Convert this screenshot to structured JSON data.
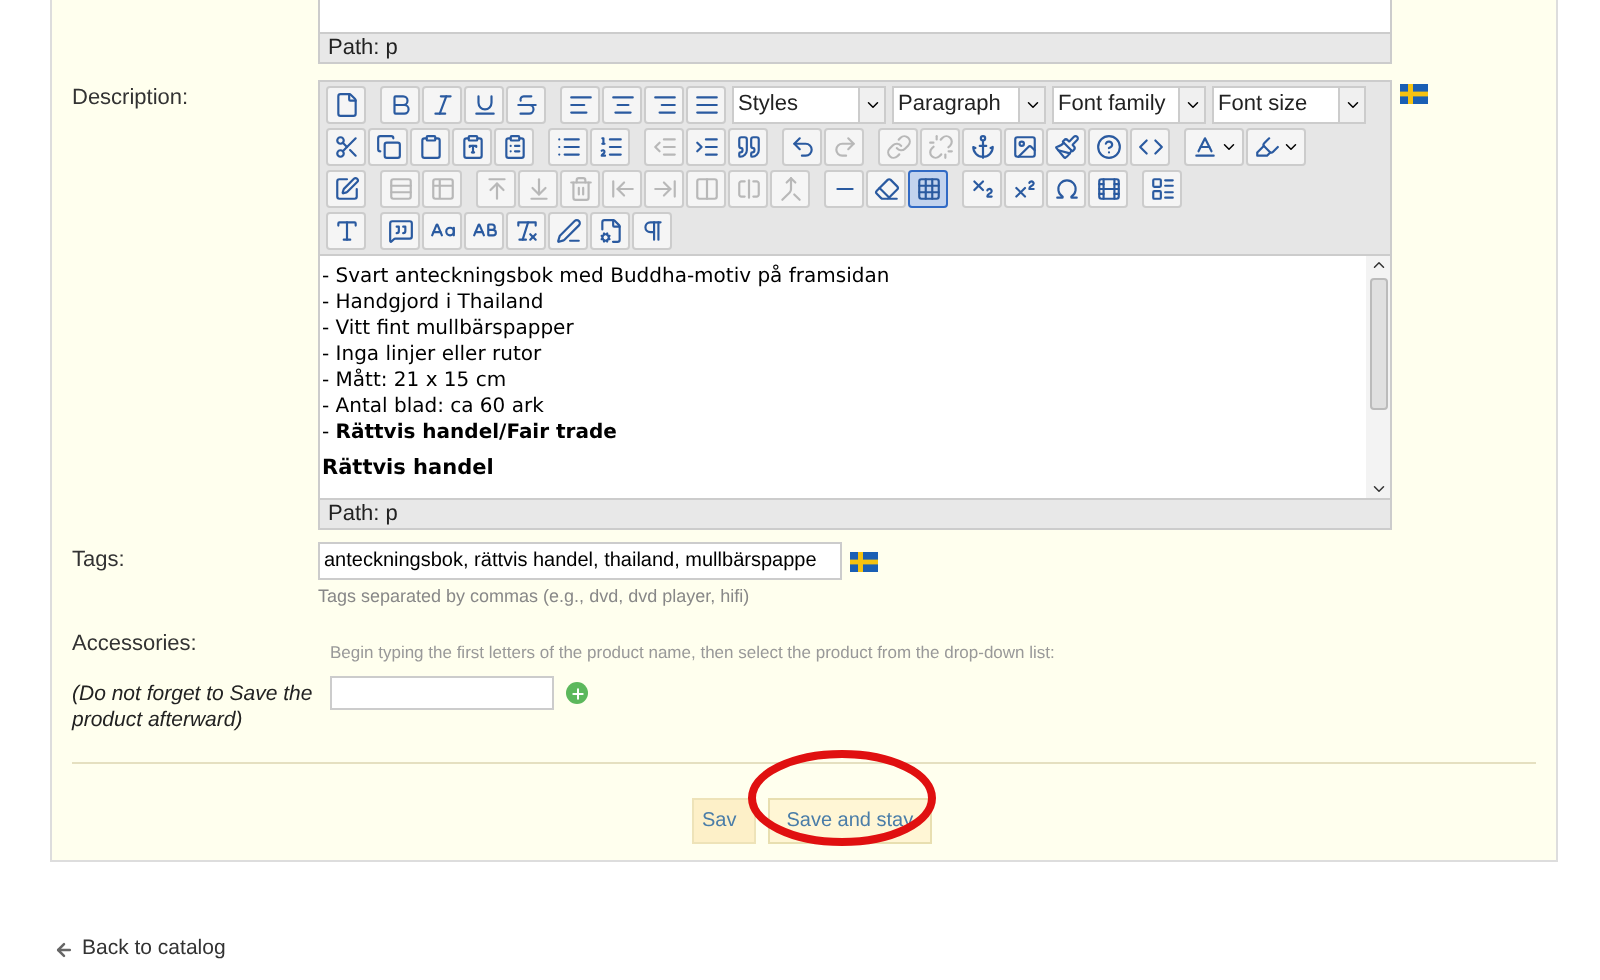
{
  "top_editor": {
    "path": "Path: p"
  },
  "description": {
    "label": "Description:",
    "toolbar_rows": [
      {
        "buttons": [
          {
            "disabled": false
          },
          {
            "disabled": false
          },
          {
            "disabled": false
          },
          {
            "disabled": false
          },
          {
            "disabled": false
          },
          {
            "disabled": false
          },
          {
            "disabled": false
          },
          {
            "disabled": false
          },
          {
            "disabled": false
          }
        ]
      },
      {
        "buttons": [
          {
            "disabled": false
          },
          {
            "disabled": false
          },
          {
            "disabled": false
          },
          {
            "disabled": false
          },
          {
            "disabled": false
          },
          {
            "disabled": false
          },
          {
            "disabled": false
          },
          {
            "disabled": true
          },
          {
            "disabled": false
          },
          {
            "disabled": false
          },
          {
            "disabled": false
          },
          {
            "disabled": true
          },
          {
            "disabled": true
          },
          {
            "disabled": true
          },
          {
            "disabled": false
          },
          {
            "disabled": false
          },
          {
            "disabled": false
          },
          {
            "disabled": false
          },
          {
            "disabled": false
          },
          {
            "disabled": false
          },
          {
            "disabled": false
          }
        ]
      },
      {
        "buttons": [
          {
            "disabled": false
          },
          {
            "disabled": true
          },
          {
            "disabled": true
          },
          {
            "disabled": true
          },
          {
            "disabled": true
          },
          {
            "disabled": true
          },
          {
            "disabled": true
          },
          {
            "disabled": true
          },
          {
            "disabled": true
          },
          {
            "disabled": true
          },
          {
            "disabled": true
          },
          {
            "disabled": false
          },
          {
            "disabled": false
          },
          {
            "disabled": false,
            "active": true
          },
          {
            "disabled": false
          },
          {
            "disabled": false
          },
          {
            "disabled": false
          },
          {
            "disabled": false
          },
          {
            "disabled": false
          }
        ]
      },
      {
        "buttons": [
          {
            "disabled": false
          },
          {
            "disabled": false
          },
          {
            "disabled": false
          },
          {
            "disabled": false
          },
          {
            "disabled": false
          },
          {
            "disabled": false
          },
          {
            "disabled": false
          },
          {
            "disabled": false
          }
        ]
      }
    ],
    "selects": [
      "Styles",
      "Paragraph",
      "Font family",
      "Font size"
    ],
    "content": [
      {
        "kind": "line",
        "text": "- Svart anteckningsbok med Buddha-motiv på framsidan"
      },
      {
        "kind": "line",
        "text": "- Handgjord i Thailand"
      },
      {
        "kind": "line",
        "text": "- Vitt fint mullbärspapper"
      },
      {
        "kind": "line",
        "text": "- Inga linjer eller rutor"
      },
      {
        "kind": "line",
        "text": "- Mått: 21 x 15 cm"
      },
      {
        "kind": "line",
        "text": "- Antal blad: ca 60 ark"
      },
      {
        "kind": "line",
        "text": "- **Rättvis handel/Fair trade**"
      },
      {
        "kind": "heading",
        "text": "Rättvis handel"
      }
    ],
    "path": "Path: p"
  },
  "tags": {
    "label": "Tags:",
    "value": "anteckningsbok, rättvis handel, thailand, mullbärspappe",
    "hint": "Tags separated by commas (e.g., dvd, dvd player, hifi)"
  },
  "accessories": {
    "label": "Accessories:",
    "hint": "Begin typing the first letters of the product name, then select the product from the drop-down list:",
    "note": "(Do not forget to Save the product afterward)"
  },
  "buttons": [
    {
      "label": "Sav",
      "highlighted": false
    },
    {
      "label": "Save and stay",
      "highlighted": true
    }
  ],
  "back_link": "Back to catalog"
}
